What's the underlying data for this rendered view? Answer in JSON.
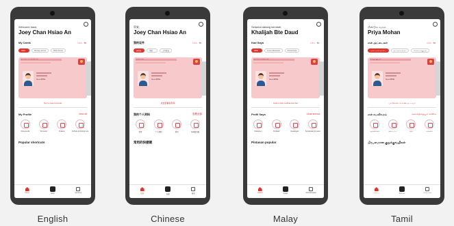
{
  "captions": [
    "English",
    "Chinese",
    "Malay",
    "Tamil"
  ],
  "phones": [
    {
      "welcome": "Welcome back,",
      "name": "Joey Chan Hsiao An",
      "cards_title": "My Cards",
      "chips": [
        "NRIC",
        "Driving Licence",
        "Work Permit"
      ],
      "card_header": "REPUBLIC OF SINGAPORE",
      "card_id": "S••••387E",
      "tap_text": "Tap to view barcode",
      "profile_title": "My Profile",
      "view_all": "View all",
      "tiles": [
        "Documents",
        "Personal",
        "Finance",
        "Vehicle & Driving Licence"
      ],
      "shortcuts_title": "Popular shortcuts",
      "tabs": [
        "Home",
        "Scan",
        "Services"
      ]
    },
    {
      "welcome": "早安,",
      "name": "Joey Chan Hsiao An",
      "cards_title": "我的证件",
      "chips": [
        "身份证",
        "驾照",
        "工作准证"
      ],
      "card_header": "新加坡共和国",
      "card_id": "S••••387E",
      "tap_text": "点击查看条形码",
      "profile_title": "我的个人资料",
      "view_all": "查看全部",
      "tiles": [
        "文件",
        "个人资料",
        "财务",
        "车辆及驾照"
      ],
      "shortcuts_title": "常用的快捷键",
      "tabs": [
        "主页",
        "扫描",
        "服务"
      ]
    },
    {
      "welcome": "Selamat datang kembali,",
      "name": "Khalijah Bte Daud",
      "cards_title": "Kad Saya",
      "chips": [
        "NRIC",
        "Lesen Memandu",
        "Permit Kerja"
      ],
      "card_header": "REPUBLIK SINGAPURA",
      "card_id": "S••••387E",
      "tap_text": "Ketik untuk melihat kod bar",
      "profile_title": "Profil Saya",
      "view_all": "Lihat semua",
      "tiles": [
        "Dokumen",
        "Peribadi",
        "Kewangan",
        "Kenderaan & Lesen"
      ],
      "shortcuts_title": "Pintasan popular",
      "tabs": [
        "Utama",
        "Imbas",
        "Perkhidmatan"
      ]
    },
    {
      "welcome": "மீண்டும் வருக,",
      "name": "Priya Mohan",
      "cards_title": "என் அட்டைகள்",
      "chips": [
        "அடையாள அட்டை",
        "ஓட்டுநர் உரிமம்",
        "வேலை அனுமதி"
      ],
      "card_header": "சிங்கப்பூர் குடியரசு",
      "card_id": "S••••387E",
      "tap_text": "பார்கோடைக் காண தட்டவும்",
      "profile_title": "என் சுயவிவரம்",
      "view_all": "அனைத்தையும் காண்க",
      "tiles": [
        "ஆவணங்கள்",
        "தனிப்பட்ட",
        "நிதி",
        "வாகனம்"
      ],
      "shortcuts_title": "பிரபலமான குறுக்குவழிகள்",
      "tabs": [
        "முகப்பு",
        "ஸ்கேன்",
        "சேவைகள்"
      ]
    }
  ],
  "colors": {
    "accent": "#e2342d",
    "card": "#f8c9cb",
    "phone_frame": "#3a3a3a"
  }
}
